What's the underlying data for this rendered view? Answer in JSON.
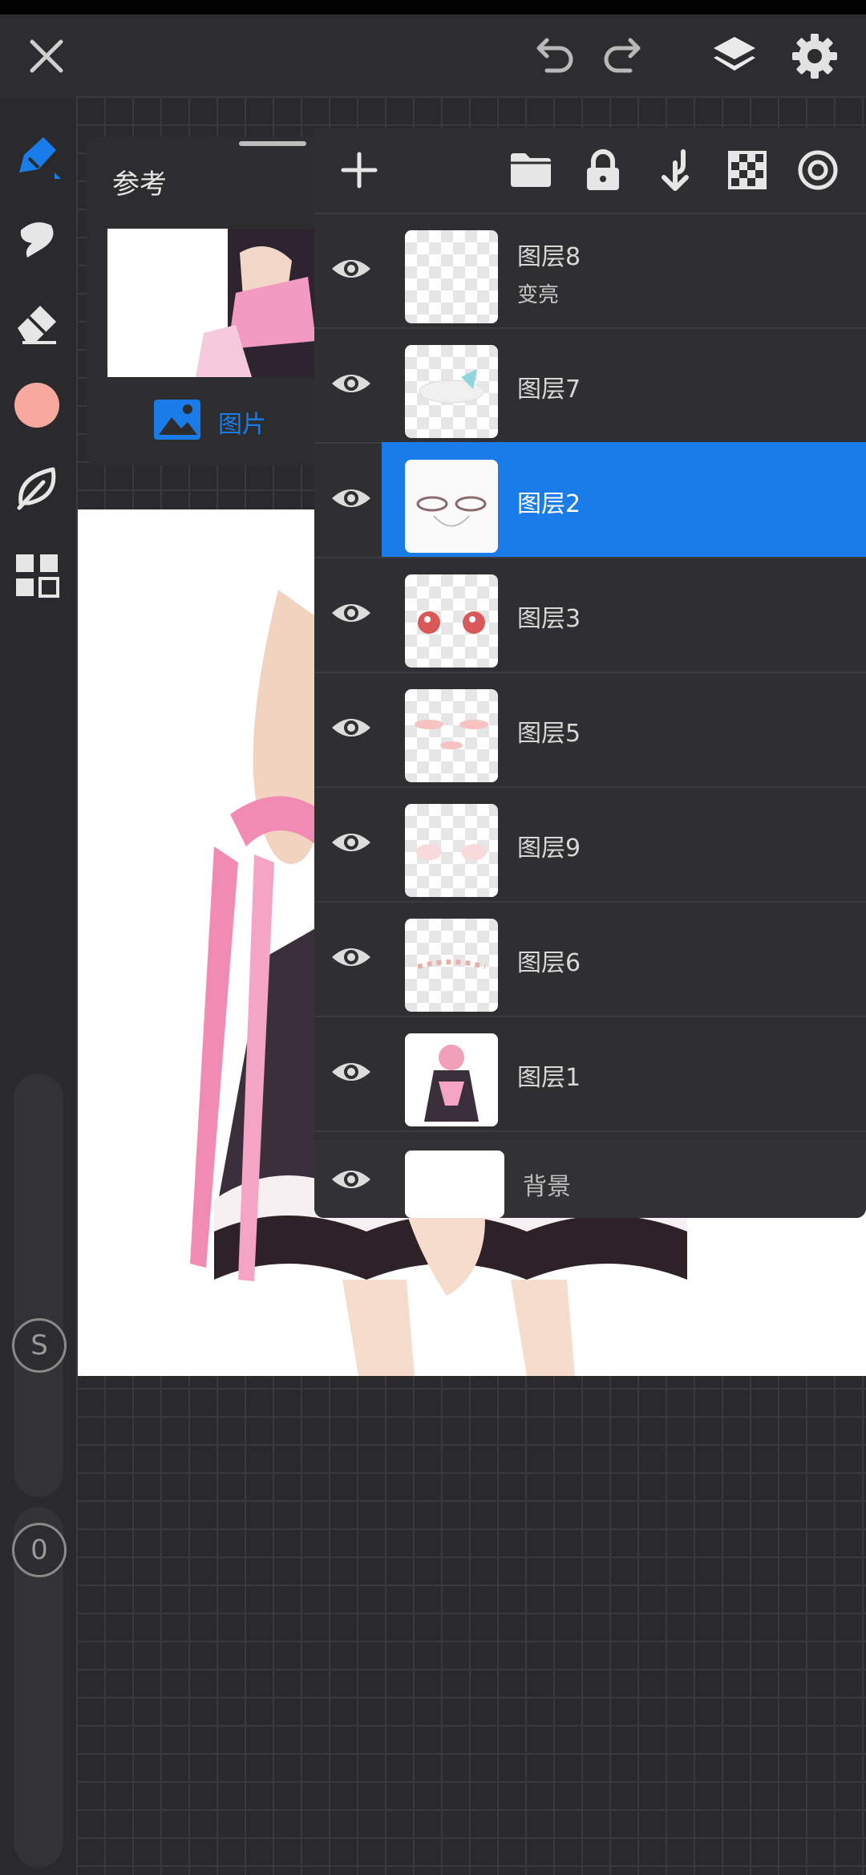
{
  "reference_panel": {
    "title": "参考",
    "tab_image_label": "图片"
  },
  "layers": [
    {
      "name": "图层8",
      "blend_mode": "变亮",
      "selected": false
    },
    {
      "name": "图层7",
      "selected": false
    },
    {
      "name": "图层2",
      "selected": true
    },
    {
      "name": "图层3",
      "selected": false
    },
    {
      "name": "图层5",
      "selected": false
    },
    {
      "name": "图层9",
      "selected": false
    },
    {
      "name": "图层6",
      "selected": false
    },
    {
      "name": "图层1",
      "selected": false
    }
  ],
  "background_layer": {
    "name": "背景"
  },
  "sliders": {
    "size_label": "S",
    "opacity_label": "0"
  },
  "colors": {
    "accent": "#1a7ce8",
    "current_color": "#f7a9a0",
    "panel_bg": "#2f2f31"
  },
  "icons": [
    "close-icon",
    "undo-icon",
    "redo-icon",
    "layers-icon",
    "settings-icon",
    "brush-icon",
    "smudge-icon",
    "eraser-icon",
    "color-swatch",
    "leaf-icon",
    "grid-icon",
    "add-icon",
    "folder-icon",
    "lock-icon",
    "merge-down-icon",
    "alpha-lock-icon",
    "target-icon",
    "eye-icon",
    "image-icon"
  ]
}
